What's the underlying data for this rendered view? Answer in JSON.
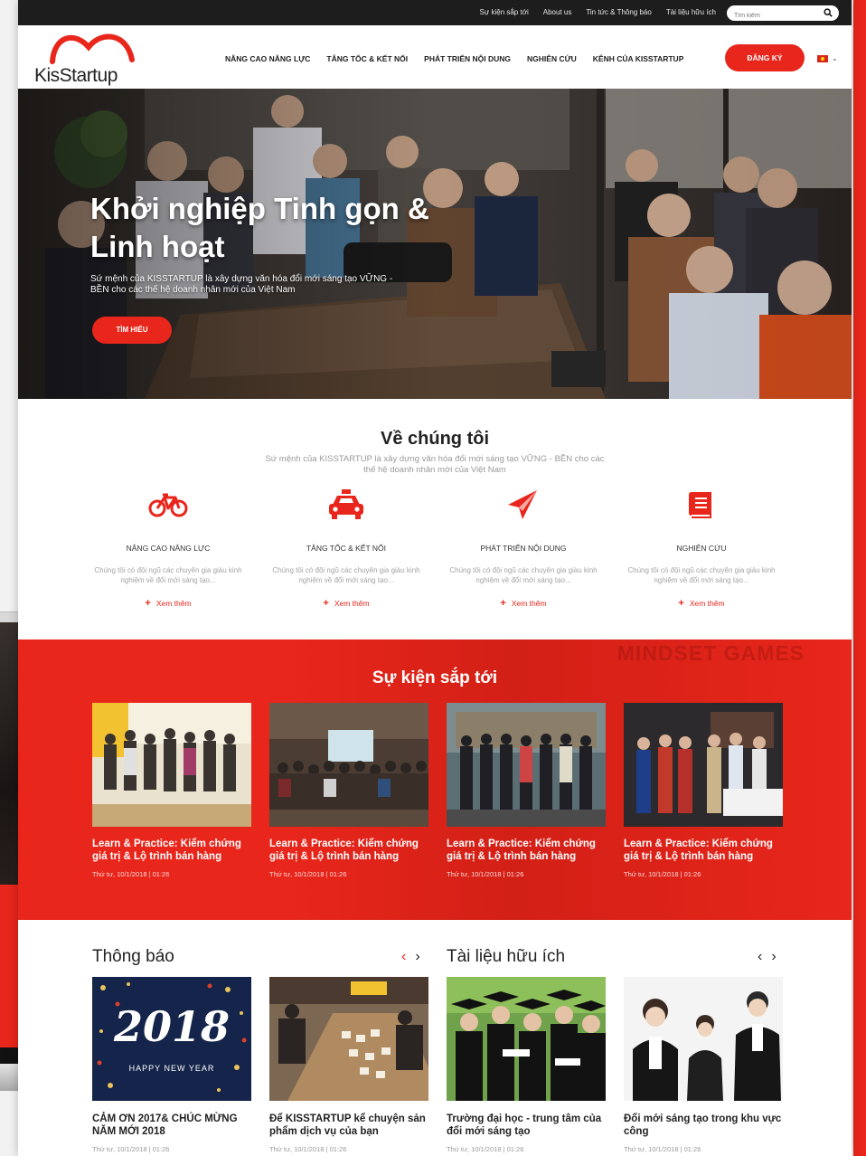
{
  "topbar": {
    "links": [
      "Sự kiện sắp tới",
      "About us",
      "Tin tức & Thông báo",
      "Tài liệu hữu ích"
    ],
    "search_placeholder": "Tìm kiếm"
  },
  "header": {
    "logo_text": "KisStartup",
    "nav": [
      "NÂNG CAO NĂNG LỰC",
      "TĂNG TỐC & KẾT NỐI",
      "PHÁT TRIỂN NỘI DUNG",
      "NGHIÊN CỨU",
      "KÊNH CỦA KISSTARTUP"
    ],
    "register_label": "ĐĂNG KÝ"
  },
  "hero": {
    "title": "Khởi nghiệp Tinh gọn & Linh hoạt",
    "subtitle": "Sứ mệnh của KISSTARTUP là xây dựng văn hóa đổi mới sáng tạo VỮNG - BỀN cho các thế hệ doanh nhân mới của Việt Nam",
    "cta": "TÌM HIỂU"
  },
  "about": {
    "title": "Về chúng tôi",
    "description": "Sứ mệnh của KISSTARTUP là xây dựng văn hóa đổi mới sáng tạo VỮNG - BỀN cho các thế hệ doanh nhân mới của Việt Nam",
    "features": [
      {
        "icon": "bicycle-icon",
        "title": "NÂNG CAO NĂNG LỰC",
        "desc": "Chúng tôi có đội ngũ các chuyên gia giàu kinh nghiệm về đổi mới sáng tạo...",
        "more": "Xem thêm"
      },
      {
        "icon": "taxi-icon",
        "title": "TĂNG TỐC & KẾT NỐI",
        "desc": "Chúng tôi có đội ngũ các chuyên gia giàu kinh nghiệm về đổi mới sáng tạo...",
        "more": "Xem thêm"
      },
      {
        "icon": "paper-plane-icon",
        "title": "PHÁT TRIỂN NỘI DUNG",
        "desc": "Chúng tôi có đội ngũ các chuyên gia giàu kinh nghiệm về đổi mới sáng tạo...",
        "more": "Xem thêm"
      },
      {
        "icon": "book-icon",
        "title": "NGHIÊN CỨU",
        "desc": "Chúng tôi có đội ngũ các chuyên gia giàu kinh nghiệm về đổi mới sáng tạo...",
        "more": "Xem thêm"
      }
    ]
  },
  "events": {
    "title": "Sự kiện sắp tới",
    "background_text": "MINDSET GAMES",
    "items": [
      {
        "title": "Learn & Practice: Kiểm chứng giá trị & Lộ trình bán hàng",
        "date": "Thứ tư, 10/1/2018 | 01:26"
      },
      {
        "title": "Learn & Practice: Kiểm chứng giá trị & Lộ trình bán hàng",
        "date": "Thứ tư, 10/1/2018 | 01:26"
      },
      {
        "title": "Learn & Practice: Kiểm chứng giá trị & Lộ trình bán hàng",
        "date": "Thứ tư, 10/1/2018 | 01:26"
      },
      {
        "title": "Learn & Practice: Kiểm chứng giá trị & Lộ trình bán hàng",
        "date": "Thứ tư, 10/1/2018 | 01:26"
      }
    ]
  },
  "notices": {
    "title": "Thông báo",
    "items": [
      {
        "title": "CẢM ƠN 2017& CHÚC MỪNG NĂM MỚI 2018",
        "date": "Thứ tư, 10/1/2018 | 01:26",
        "image_text": "2018",
        "image_caption": "HAPPY NEW YEAR"
      },
      {
        "title": "Để KISSTARTUP kể chuyện sản phẩm dịch vụ của bạn",
        "date": "Thứ tư, 10/1/2018 | 01:26"
      }
    ]
  },
  "resources": {
    "title": "Tài liệu hữu ích",
    "items": [
      {
        "title": "Trường đại học - trung tâm của đổi mới sáng tạo",
        "date": "Thứ tư, 10/1/2018 | 01:26"
      },
      {
        "title": "Đổi mới sáng tạo trong khu vực công",
        "date": "Thứ tư, 10/1/2018 | 01:26"
      }
    ]
  },
  "colors": {
    "accent": "#e8261b",
    "dark": "#1d1d1d"
  }
}
